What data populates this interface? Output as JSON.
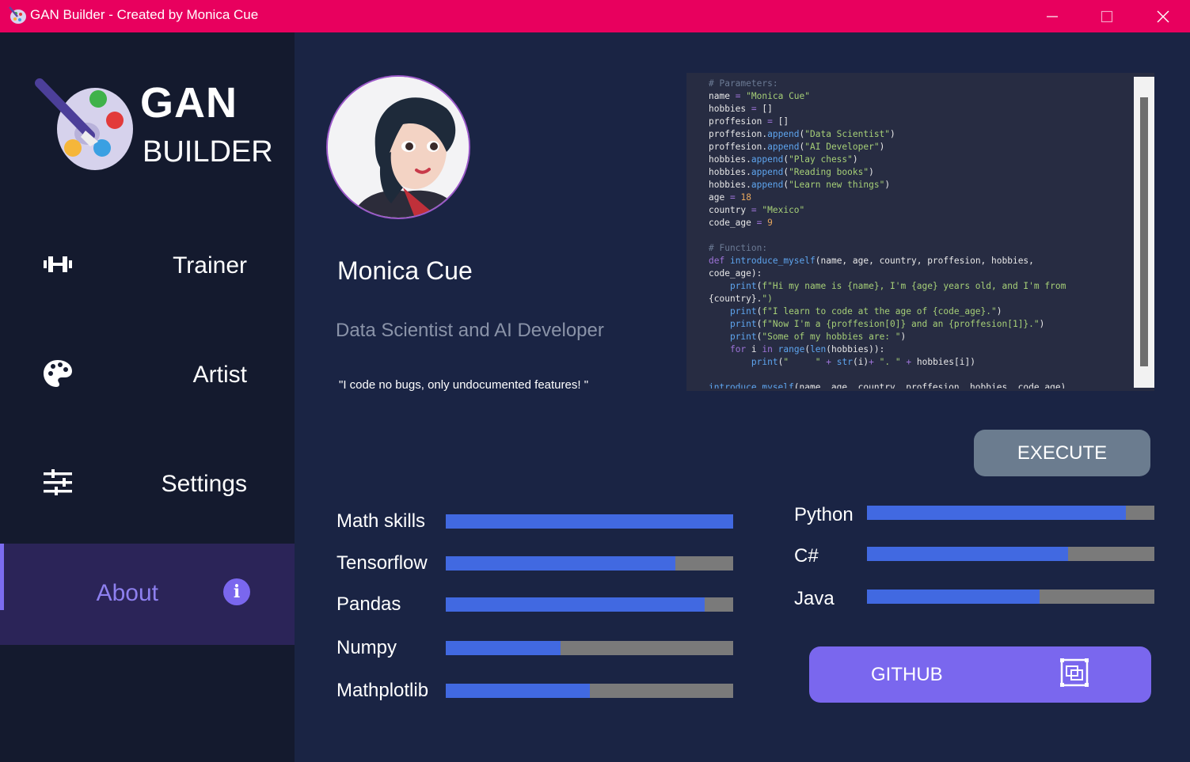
{
  "window": {
    "title": "GAN Builder - Created by Monica Cue",
    "app_icon": "palette-icon",
    "accent_color": "#e8005e"
  },
  "sidebar": {
    "logo_top": "GAN",
    "logo_bottom": "BUILDER",
    "items": [
      {
        "label": "Trainer",
        "icon": "dumbbell-icon",
        "active": false
      },
      {
        "label": "Artist",
        "icon": "palette-icon",
        "active": false
      },
      {
        "label": "Settings",
        "icon": "sliders-icon",
        "active": false
      },
      {
        "label": "About",
        "icon": "info-icon",
        "active": true
      }
    ]
  },
  "profile": {
    "name": "Monica Cue",
    "role": "Data Scientist and AI Developer",
    "quote": "\"I code no bugs, only undocumented features! \""
  },
  "code": {
    "lines": [
      "# Parameters:",
      "name = \"Monica Cue\"",
      "hobbies = []",
      "proffesion = []",
      "proffesion.append(\"Data Scientist\")",
      "proffesion.append(\"AI Developer\")",
      "hobbies.append(\"Play chess\")",
      "hobbies.append(\"Reading books\")",
      "hobbies.append(\"Learn new things\")",
      "age = 18",
      "country = \"Mexico\"",
      "code_age = 9",
      "",
      "# Function:",
      "def introduce_myself(name, age, country, proffesion, hobbies,",
      "code_age):",
      "    print(f\"Hi my name is {name}, I'm {age} years old, and I'm from",
      "{country}.\")",
      "    print(f\"I learn to code at the age of {code_age}.\")",
      "    print(f\"Now I'm a {proffesion[0]} and an {proffesion[1]}.\")",
      "    print(\"Some of my hobbies are: \")",
      "    for i in range(len(hobbies)):",
      "        print(\"     \" + str(i)+ \". \" + hobbies[i])",
      "",
      "introduce_myself(name, age, country, proffesion, hobbies, code_age)"
    ]
  },
  "buttons": {
    "execute": "EXECUTE",
    "github": "GITHUB",
    "github_icon": "open-window-icon"
  },
  "skills_left": [
    {
      "label": "Math skills",
      "level": 100
    },
    {
      "label": "Tensorflow",
      "level": 80
    },
    {
      "label": "Pandas",
      "level": 90
    },
    {
      "label": "Numpy",
      "level": 40
    },
    {
      "label": "Mathplotlib",
      "level": 50
    }
  ],
  "skills_right": [
    {
      "label": "Python",
      "level": 90
    },
    {
      "label": "C#",
      "level": 70
    },
    {
      "label": "Java",
      "level": 60
    }
  ],
  "colors": {
    "sidebar_bg": "#141a2e",
    "main_bg": "#1a2444",
    "active_nav_bg": "#2b2458",
    "bar_fill": "#4169e1",
    "bar_track": "#7a7a7a",
    "github_button": "#7a67ee",
    "execute_button": "#6b7c8f"
  }
}
